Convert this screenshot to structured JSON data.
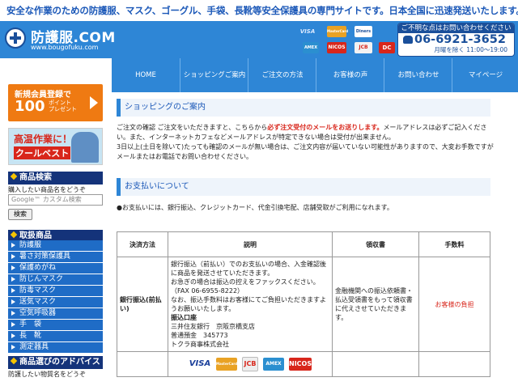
{
  "header": {
    "tagline": "安全な作業のための防護服、マスク、ゴーグル、手袋、長靴等安全保護具の専門サイトです。日本全国に迅速発送いたします。",
    "logo_name": "防護服.COM",
    "logo_url": "www.bougofuku.com",
    "phone_title": "ご不明な点はお問い合わせください",
    "phone_number": "06-6921-3652",
    "phone_hours": "月曜を除く 11:00～19:00",
    "cards": [
      "VISA",
      "MasterCard",
      "Diners",
      "AMEX",
      "NICOS",
      "JCB",
      "DC"
    ]
  },
  "nav": [
    "HOME",
    "ショッピングご案内",
    "ご注文の方法",
    "お客様の声",
    "お問い合わせ",
    "マイページ"
  ],
  "sidebar": {
    "promo1": {
      "line1": "新規会員登録で",
      "line2": "100",
      "line3": "ポイント\nプレゼント"
    },
    "promo2": {
      "line1": "高温作業に！",
      "line2": "クールベスト"
    },
    "search_heading": "商品検索",
    "search_sub": "購入したい商品名をどうぞ",
    "search_placeholder": "Google™ カスタム検索",
    "search_button": "検索",
    "categories_heading": "取扱商品",
    "categories": [
      "防護服",
      "暑さ対策保護具",
      "保護めがね",
      "防じんマスク",
      "防毒マスク",
      "送気マスク",
      "空気呼吸器",
      "手　袋",
      "長　靴",
      "測定器具"
    ],
    "advice_heading": "商品選びのアドバイス",
    "advice_sub": "防護したい物質名をどうぞ"
  },
  "main": {
    "title1": "ショッピングのご案内",
    "para1_a": "ご注文の確認 ご注文をいただきますと、こちらから",
    "para1_red": "必ず注文受付のメールをお送りします。",
    "para1_b": "メールアドレスは必ずご記入ください。また、インターネットカフェなどメールアドレスが特定できない場合は受付が出来ません。",
    "para1_c": "3日以上(土日を除いて)たっても確認のメールが無い場合は、ご注文内容が届いていない可能性がありますので、大変お手数ですがメールまたはお電話でお問い合わせください。",
    "title2": "お支払いについて",
    "para2": "●お支払いには、銀行振込、クレジットカード、代金引換宅配、店舗受取がご利用になれます。",
    "table": {
      "headers": [
        "決済方法",
        "説明",
        "領収書",
        "手数料"
      ],
      "row1": {
        "method": "銀行振込(前払い)",
        "desc1": "銀行振込（前払い）でのお支払いの場合、入金確認後に商品を発送させていただきます。",
        "desc2": "お急ぎの場合は振込の控えをファックスください。（FAX 06-6955-8222）",
        "desc3": "なお、振込手数料はお客様にてご負担いただきますようお願いいたします。",
        "account_label": "振込口座",
        "account1": "三井住友銀行　京阪京橋支店",
        "account2": "普通預金　345773",
        "account3": "トクラ商事株式会社",
        "receipt": "金融機関への振込依頼書・払込受領書をもって領収書に代えさせていただきます。",
        "fee": "お客様の負担"
      },
      "row2_logos": [
        "VISA",
        "MasterCard",
        "JCB",
        "AMEX",
        "NICOS"
      ]
    }
  },
  "colors": {
    "brand_blue": "#2e86d6",
    "dark_blue": "#14337a",
    "accent_red": "#d8261b",
    "orange": "#ef7a12"
  }
}
